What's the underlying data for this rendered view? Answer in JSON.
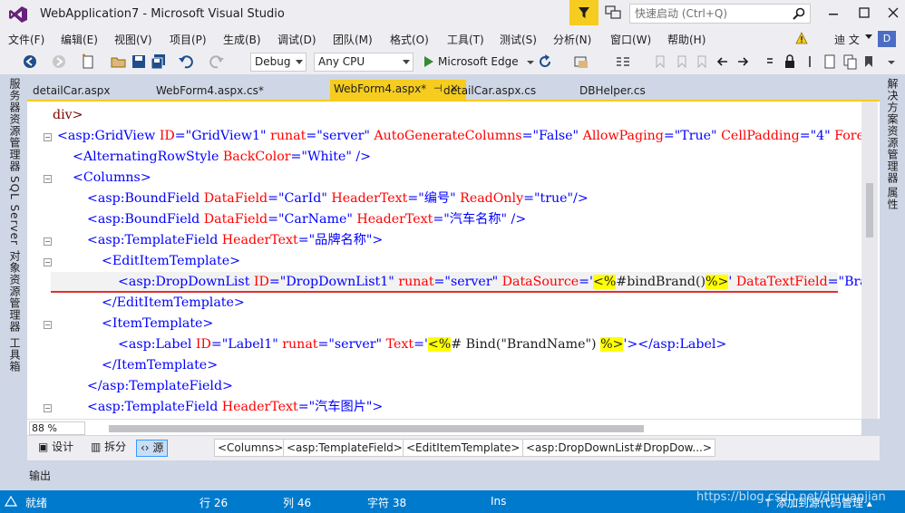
{
  "window": {
    "title": "WebApplication7 - Microsoft Visual Studio",
    "quick_launch_placeholder": "快速启动 (Ctrl+Q)"
  },
  "menu": [
    "文件(F)",
    "编辑(E)",
    "视图(V)",
    "项目(P)",
    "生成(B)",
    "调试(D)",
    "团队(M)",
    "格式(O)",
    "工具(T)",
    "测试(S)",
    "分析(N)",
    "窗口(W)",
    "帮助(H)"
  ],
  "user": {
    "name": "迪 文",
    "avatar": "D"
  },
  "toolbar": {
    "config": "Debug",
    "platform": "Any CPU",
    "browser": "Microsoft Edge"
  },
  "left_panels": [
    "服务器资源管理器",
    "SQL Server 对象资源管理器",
    "工具箱"
  ],
  "right_panels": [
    "解决方案资源管理器",
    "属性"
  ],
  "tabs": [
    {
      "label": "detailCar.aspx"
    },
    {
      "label": "WebForm4.aspx.cs*"
    },
    {
      "label": "WebForm4.aspx*",
      "pin": "⊣",
      "close": "×"
    },
    {
      "label": "detailCar.aspx.cs"
    },
    {
      "label": "DBHelper.cs"
    }
  ],
  "code": {
    "l1": [
      "div>"
    ],
    "l2": [
      "<asp:GridView ",
      "ID",
      "=\"GridView1\" ",
      "runat",
      "=\"server\" ",
      "AutoGenerateColumns",
      "=\"False\" ",
      "AllowPaging",
      "=\"True\" ",
      "CellPadding",
      "=\"4\" ",
      "ForeColor",
      "=\"#"
    ],
    "l3": [
      "<AlternatingRowStyle ",
      "BackColor",
      "=\"White\" />"
    ],
    "l4": [
      "<Columns>"
    ],
    "l5": [
      "<asp:BoundField ",
      "DataField",
      "=\"CarId\" ",
      "HeaderText",
      "=\"编号\" ",
      "ReadOnly",
      "=\"true\"/>"
    ],
    "l6": [
      "<asp:BoundField ",
      "DataField",
      "=\"CarName\" ",
      "HeaderText",
      "=\"汽车名称\" />"
    ],
    "l7": [
      "<asp:TemplateField ",
      "HeaderText",
      "=\"品牌名称\">"
    ],
    "l8": [
      "<EditItemTemplate>"
    ],
    "l9": [
      "<asp:DropDownList ",
      "ID",
      "=\"DropDownList1\" ",
      "runat",
      "=\"server\" ",
      "DataSource",
      "='",
      "<%",
      "#bindBrand()",
      "%>",
      "' ",
      "DataTextField",
      "=\"BrandNa"
    ],
    "l10": [
      "</EditItemTemplate>"
    ],
    "l11": [
      "<ItemTemplate>"
    ],
    "l12": [
      "<asp:Label ",
      "ID",
      "=\"Label1\" ",
      "runat",
      "=\"server\" ",
      "Text",
      "='",
      "<%",
      "# Bind(\"BrandName\") ",
      "%>",
      "'></asp:Label>"
    ],
    "l13": [
      "</ItemTemplate>"
    ],
    "l14": [
      "</asp:TemplateField>"
    ],
    "l15": [
      "<asp:TemplateField ",
      "HeaderText",
      "=\"汽车图片\">"
    ]
  },
  "zoom": "88 %",
  "view_buttons": {
    "design": "设计",
    "split": "拆分",
    "source": "源"
  },
  "breadcrumbs": [
    "<Columns>",
    "<asp:TemplateField>",
    "<EditItemTemplate>",
    "<asp:DropDownList#DropDow...>"
  ],
  "output_label": "输出",
  "status": {
    "ready": "就绪",
    "line": "行 26",
    "col": "列 46",
    "char": "字符 38",
    "mode": "Ins",
    "source_control": "添加到源代码管理"
  },
  "watermark": "https://blog.csdn.net/dnruanjian",
  "colors": {
    "accent": "#f5cc1f",
    "status": "#007acc",
    "chrome": "#eeeef2",
    "frame": "#cfd6e5"
  }
}
